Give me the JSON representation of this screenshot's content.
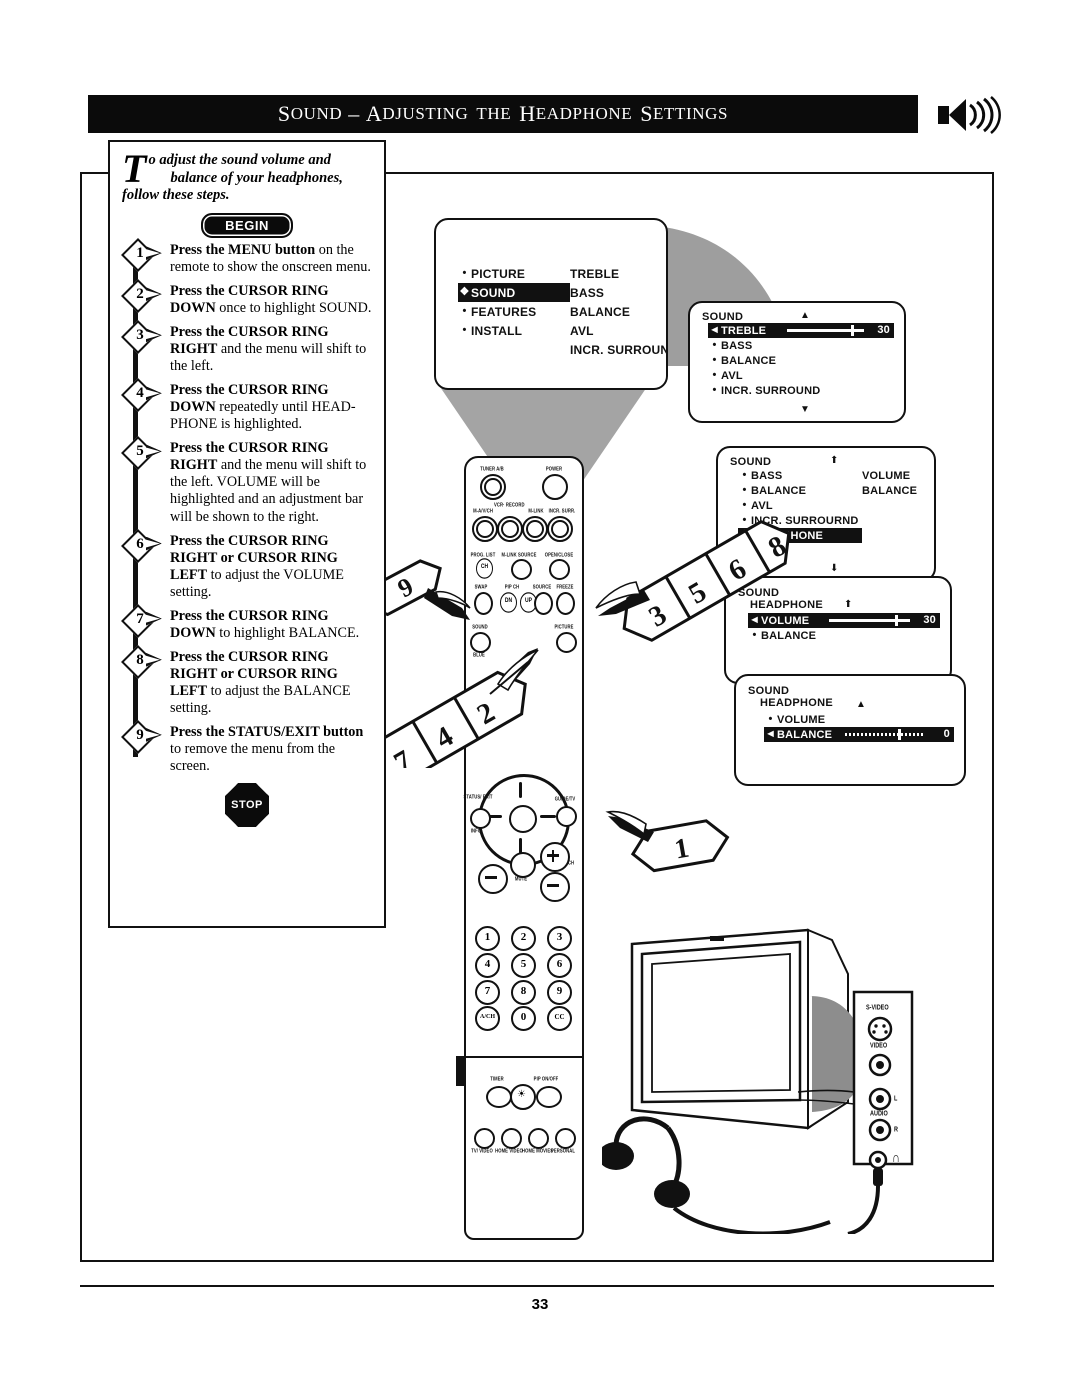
{
  "page": {
    "title_words": [
      "Sound",
      "–",
      "Adjusting",
      "the",
      "Headphone",
      "Settings"
    ],
    "title_full": "SOUND – ADJUSTING THE HEADPHONE SETTINGS",
    "number": "33",
    "header_icon": "speaker-sound-icon"
  },
  "intro": {
    "dropcap": "T",
    "line1": "o adjust the sound volume and",
    "line2": "balance of your headphones,",
    "line3": "follow these steps."
  },
  "badges": {
    "begin": "BEGIN",
    "stop": "STOP"
  },
  "steps": [
    {
      "num": "1",
      "text": "Press the MENU button on the remote to show the onscreen menu.",
      "bold_prefix": "Press the MENU button",
      "rest": " on the remote to show the onscreen menu."
    },
    {
      "num": "2",
      "text": "Press the CURSOR RING DOWN once to highlight SOUND.",
      "bold_prefix": "Press the CURSOR RING DOWN",
      "rest": " once to highlight SOUND."
    },
    {
      "num": "3",
      "text": "Press the CURSOR RING RIGHT and the menu will shift to the left.",
      "bold_prefix": "Press the CURSOR RING RIGHT",
      "rest": " and the menu will shift to the left."
    },
    {
      "num": "4",
      "text": "Press the CURSOR RING DOWN repeatedly until HEAD-PHONE is highlighted.",
      "bold_prefix": "Press the CURSOR RING DOWN",
      "rest": " repeatedly until HEAD-PHONE is highlighted."
    },
    {
      "num": "5",
      "text": "Press the CURSOR RING RIGHT and the menu will shift to the left. VOLUME will be highlighted and an adjustment bar will be shown to the right.",
      "bold_prefix": "Press the CURSOR RING RIGHT",
      "rest": " and the menu will shift to the left. VOLUME will be highlighted and an adjustment bar will be shown to the right."
    },
    {
      "num": "6",
      "text": "Press the CURSOR RING RIGHT or CURSOR RING LEFT to adjust the VOLUME setting.",
      "bold_prefix": "Press the CURSOR RING RIGHT or CURSOR RING LEFT",
      "rest": " to adjust the VOLUME setting."
    },
    {
      "num": "7",
      "text": "Press the CURSOR RING DOWN to highlight BALANCE.",
      "bold_prefix": "Press the CURSOR RING DOWN",
      "rest": " to highlight BALANCE."
    },
    {
      "num": "8",
      "text": "Press the CURSOR RING RIGHT or CURSOR RING LEFT to adjust the BALANCE setting.",
      "bold_prefix": "Press the CURSOR RING RIGHT or CURSOR RING LEFT",
      "rest": " to adjust the BALANCE setting."
    },
    {
      "num": "9",
      "text": "Press the STATUS/EXIT button to remove the menu from the screen.",
      "bold_prefix": "Press the STATUS/EXIT button",
      "rest": " to remove the menu from the screen."
    }
  ],
  "screens": [
    {
      "id": "main-menu",
      "left_items": [
        {
          "label": "PICTURE",
          "highlighted": false
        },
        {
          "label": "SOUND",
          "highlighted": true
        },
        {
          "label": "FEATURES",
          "highlighted": false
        },
        {
          "label": "INSTALL",
          "highlighted": false
        }
      ],
      "right_items": [
        "TREBLE",
        "BASS",
        "BALANCE",
        "AVL",
        "INCR. SURROUND"
      ]
    },
    {
      "id": "sound-menu",
      "header": "SOUND",
      "items": [
        {
          "label": "TREBLE",
          "highlighted": true,
          "bar": true,
          "value": "30"
        },
        {
          "label": "BASS",
          "highlighted": false
        },
        {
          "label": "BALANCE",
          "highlighted": false
        },
        {
          "label": "AVL",
          "highlighted": false
        },
        {
          "label": "INCR. SURROUND",
          "highlighted": false
        }
      ],
      "scroll_up": "▲",
      "scroll_down": "▼"
    },
    {
      "id": "sound-headphone-select",
      "header": "SOUND",
      "items": [
        {
          "label": "BASS",
          "highlighted": false
        },
        {
          "label": "BALANCE",
          "highlighted": false
        },
        {
          "label": "AVL",
          "highlighted": false
        },
        {
          "label": "INCR. SURROURND",
          "highlighted": false
        },
        {
          "label": "HEADPHONE",
          "highlighted": true
        }
      ],
      "right_items": [
        "VOLUME",
        "BALANCE"
      ],
      "scroll_up": "⬆",
      "scroll_down": "⬇"
    },
    {
      "id": "headphone-volume",
      "header": "SOUND",
      "subheader": "HEADPHONE",
      "items": [
        {
          "label": "VOLUME",
          "highlighted": true,
          "bar": true,
          "value": "30"
        },
        {
          "label": "BALANCE",
          "highlighted": false
        }
      ],
      "scroll_up": "⬆"
    },
    {
      "id": "headphone-balance",
      "header": "SOUND",
      "subheader": "HEADPHONE",
      "items": [
        {
          "label": "VOLUME",
          "highlighted": false
        },
        {
          "label": "BALANCE",
          "highlighted": true,
          "bar": true,
          "value": "0"
        }
      ],
      "scroll_up": "▲"
    }
  ],
  "callouts": [
    {
      "numbers": [
        "9"
      ],
      "target": "status-exit-button"
    },
    {
      "numbers": [
        "7",
        "4",
        "2"
      ],
      "target": "cursor-ring-down"
    },
    {
      "numbers": [
        "3",
        "5",
        "6",
        "8"
      ],
      "target": "cursor-ring-right"
    },
    {
      "numbers": [
        "1"
      ],
      "target": "menu-button"
    }
  ],
  "remote": {
    "labels_row1": [
      "TUNER A/B",
      "POWER"
    ],
    "labels_row2": [
      "M-A/V/CH",
      "VCR· RECORD",
      "M-LINK",
      "INCR. SURR."
    ],
    "labels_row3": [
      "PROG. LIST",
      "M-LINK SOURCE",
      "OPEN/CLOSE"
    ],
    "labels_row4": [
      "SWAP",
      "PIP CH",
      "SOURCE",
      "FREEZE"
    ],
    "pip_up": "UP",
    "pip_dn": "DN",
    "prog_list_btn": "CH",
    "labels_row5": [
      "SOUND",
      "PICTURE"
    ],
    "label_blue": "BLUE",
    "label_status": "STATUS/ EXIT",
    "label_info": "INFO",
    "label_guide": "GUIDE/TV",
    "label_mute": "MUTE",
    "label_ch": "CH",
    "keypad": [
      "1",
      "2",
      "3",
      "4",
      "5",
      "6",
      "7",
      "8",
      "9"
    ],
    "keypad_extra": [
      "A/CH",
      "0",
      "CC"
    ],
    "labels_bottom_top": [
      "TIMER",
      "PIP ON/OFF"
    ],
    "labels_bottom": [
      "TV/ VIDEO",
      "HOME VIDEO",
      "HOME MOVIES",
      "PERSONAL"
    ]
  },
  "jack_panel": {
    "labels": [
      "S-VIDEO",
      "VIDEO",
      "L",
      "AUDIO",
      "R"
    ],
    "headphone_symbol": "∩"
  },
  "colors": {
    "ink": "#111111",
    "paper": "#ffffff",
    "title_bg": "#0b0b0b"
  }
}
